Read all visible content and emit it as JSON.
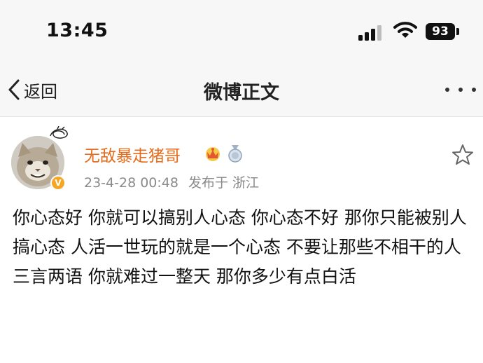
{
  "status_bar": {
    "time": "13:45",
    "battery": "93",
    "icons": [
      "signal-icon",
      "wifi-icon",
      "battery-icon"
    ]
  },
  "nav": {
    "back_label": "返回",
    "title": "微博正文",
    "icons": [
      "chevron-left-icon",
      "more-icon"
    ]
  },
  "post": {
    "author": "无敌暴走猪哥",
    "date": "23-4-28 00:48",
    "source": "发布于 浙江",
    "text": "你心态好 你就可以搞别人心态 你心态不好 那你只能被别人搞心态 人活一世玩的就是一个心态 不要让那些不相干的人三言两语 你就难过一整天 那你多少有点白活",
    "icons": [
      "avatar",
      "verified-v-icon",
      "crown-badge-icon",
      "medal-badge-icon",
      "star-icon"
    ]
  },
  "colors": {
    "author": "#e86b1a",
    "meta": "#8a8a8a",
    "bar_bg": "#f7f7f7",
    "verify": "#f5a623"
  }
}
